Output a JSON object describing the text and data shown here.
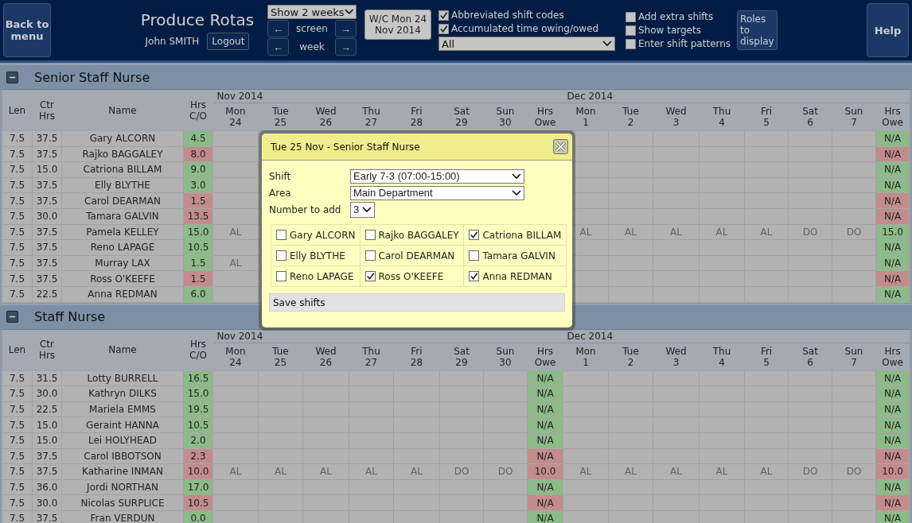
{
  "header": {
    "back_button": "Back to menu",
    "title": "Produce Rotas",
    "user": "John SMITH",
    "logout_button": "Logout",
    "range_select": "Show 2 weeks",
    "nav": [
      {
        "prev": "←",
        "label": "screen",
        "next": "→"
      },
      {
        "prev": "←",
        "label": "week",
        "next": "→"
      }
    ],
    "week_button": "W/C Mon 24 Nov 2014",
    "options": [
      {
        "label": "Abbreviated shift codes",
        "checked": true
      },
      {
        "label": "Accumulated time owing/owed",
        "checked": true
      }
    ],
    "filter_select": "All",
    "options_2": [
      {
        "label": "Add extra shifts",
        "checked": false
      },
      {
        "label": "Show targets",
        "checked": false
      },
      {
        "label": "Enter shift patterns",
        "checked": false
      }
    ],
    "roles_button": "Roles to display",
    "help_button": "Help"
  },
  "sections": [
    {
      "title": "Senior Staff Nurse",
      "expanded": true,
      "columns": [
        "Len",
        "Ctr Hrs",
        "Name",
        "Hrs C/O"
      ],
      "weeks": [
        {
          "month": "Nov 2014",
          "days": [
            {
              "day": "Mon",
              "date": "24"
            },
            {
              "day": "Tue",
              "date": "25"
            },
            {
              "day": "Wed",
              "date": "26"
            },
            {
              "day": "Thu",
              "date": "27"
            },
            {
              "day": "Fri",
              "date": "28"
            },
            {
              "day": "Sat",
              "date": "29"
            },
            {
              "day": "Sun",
              "date": "30"
            }
          ],
          "owe_header": "Hrs Owe"
        },
        {
          "month": "Dec 2014",
          "days": [
            {
              "day": "Mon",
              "date": "1"
            },
            {
              "day": "Tue",
              "date": "2"
            },
            {
              "day": "Wed",
              "date": "3"
            },
            {
              "day": "Thu",
              "date": "4"
            },
            {
              "day": "Fri",
              "date": "5"
            },
            {
              "day": "Sat",
              "date": "6"
            },
            {
              "day": "Sun",
              "date": "7"
            }
          ],
          "owe_header": "Hrs Owe"
        }
      ],
      "rows": [
        {
          "len": "7.5",
          "ctr": "37.5",
          "name": "Gary ALCORN",
          "co": {
            "text": "4.5",
            "color": "#8cba88"
          },
          "week2_owe": {
            "text": "N/A",
            "color": "#8cba88"
          }
        },
        {
          "len": "7.5",
          "ctr": "37.5",
          "name": "Rajko BAGGALEY",
          "co": {
            "text": "8.0",
            "color": "#c28c8c"
          },
          "week2_owe": {
            "text": "N/A",
            "color": "#c28c8c"
          }
        },
        {
          "len": "7.5",
          "ctr": "15.0",
          "name": "Catriona BILLAM",
          "co": {
            "text": "9.0",
            "color": "#8cba88"
          },
          "week2_owe": {
            "text": "N/A",
            "color": "#8cba88"
          }
        },
        {
          "len": "7.5",
          "ctr": "37.5",
          "name": "Elly BLYTHE",
          "co": {
            "text": "3.0",
            "color": "#8cba88"
          },
          "week2_owe": {
            "text": "N/A",
            "color": "#8cba88"
          }
        },
        {
          "len": "7.5",
          "ctr": "37.5",
          "name": "Carol DEARMAN",
          "co": {
            "text": "1.5",
            "color": "#c28c8c"
          },
          "week2_owe": {
            "text": "N/A",
            "color": "#c28c8c"
          }
        },
        {
          "len": "7.5",
          "ctr": "30.0",
          "name": "Tamara GALVIN",
          "co": {
            "text": "13.5",
            "color": "#c28c8c"
          },
          "week2_owe": {
            "text": "N/A",
            "color": "#c28c8c"
          }
        },
        {
          "len": "7.5",
          "ctr": "37.5",
          "name": "Pamela KELLEY",
          "co": {
            "text": "15.0",
            "color": "#8cba88"
          },
          "week1_shifts": [
            "AL"
          ],
          "week2_shifts": [
            "AL",
            "AL",
            "AL",
            "AL",
            "AL",
            "DO",
            "DO"
          ],
          "week2_owe": {
            "text": "15.0",
            "color": "#8cba88"
          }
        },
        {
          "len": "7.5",
          "ctr": "37.5",
          "name": "Reno LAPAGE",
          "co": {
            "text": "10.5",
            "color": "#8cba88"
          },
          "week2_owe": {
            "text": "N/A",
            "color": "#8cba88"
          }
        },
        {
          "len": "7.5",
          "ctr": "37.5",
          "name": "Murray LAX",
          "co": {
            "text": "1.5",
            "color": "#8cba88"
          },
          "week1_shifts": [
            "AL"
          ],
          "week2_owe": {
            "text": "N/A",
            "color": "#8cba88"
          }
        },
        {
          "len": "7.5",
          "ctr": "37.5",
          "name": "Ross O'KEEFE",
          "co": {
            "text": "1.5",
            "color": "#c28c8c"
          },
          "week2_owe": {
            "text": "N/A",
            "color": "#c28c8c"
          }
        },
        {
          "len": "7.5",
          "ctr": "22.5",
          "name": "Anna REDMAN",
          "co": {
            "text": "6.0",
            "color": "#8cba88"
          },
          "week2_owe": {
            "text": "N/A",
            "color": "#8cba88"
          }
        }
      ]
    },
    {
      "title": "Staff Nurse",
      "expanded": true,
      "columns": [
        "Len",
        "Ctr Hrs",
        "Name",
        "Hrs C/O"
      ],
      "weeks": [
        {
          "month": "Nov 2014",
          "days": [
            {
              "day": "Mon",
              "date": "24"
            },
            {
              "day": "Tue",
              "date": "25"
            },
            {
              "day": "Wed",
              "date": "26"
            },
            {
              "day": "Thu",
              "date": "27"
            },
            {
              "day": "Fri",
              "date": "28"
            },
            {
              "day": "Sat",
              "date": "29"
            },
            {
              "day": "Sun",
              "date": "30"
            }
          ],
          "owe_header": "Hrs Owe"
        },
        {
          "month": "Dec 2014",
          "days": [
            {
              "day": "Mon",
              "date": "1"
            },
            {
              "day": "Tue",
              "date": "2"
            },
            {
              "day": "Wed",
              "date": "3"
            },
            {
              "day": "Thu",
              "date": "4"
            },
            {
              "day": "Fri",
              "date": "5"
            },
            {
              "day": "Sat",
              "date": "6"
            },
            {
              "day": "Sun",
              "date": "7"
            }
          ],
          "owe_header": "Hrs Owe"
        }
      ],
      "rows": [
        {
          "len": "7.5",
          "ctr": "31.5",
          "name": "Lotty BURRELL",
          "co": {
            "text": "16.5",
            "color": "#8cba88"
          },
          "week1_owe": {
            "text": "N/A",
            "color": "#8cba88"
          },
          "week2_owe": {
            "text": "N/A",
            "color": "#8cba88"
          }
        },
        {
          "len": "7.5",
          "ctr": "30.0",
          "name": "Kathryn DILKS",
          "co": {
            "text": "15.0",
            "color": "#8cba88"
          },
          "week1_owe": {
            "text": "N/A",
            "color": "#8cba88"
          },
          "week2_owe": {
            "text": "N/A",
            "color": "#8cba88"
          }
        },
        {
          "len": "7.5",
          "ctr": "22.5",
          "name": "Mariela EMMS",
          "co": {
            "text": "19.5",
            "color": "#8cba88"
          },
          "week1_owe": {
            "text": "N/A",
            "color": "#8cba88"
          },
          "week2_owe": {
            "text": "N/A",
            "color": "#8cba88"
          }
        },
        {
          "len": "7.5",
          "ctr": "15.0",
          "name": "Geraint HANNA",
          "co": {
            "text": "10.5",
            "color": "#8cba88"
          },
          "week1_owe": {
            "text": "N/A",
            "color": "#8cba88"
          },
          "week2_owe": {
            "text": "N/A",
            "color": "#8cba88"
          }
        },
        {
          "len": "7.5",
          "ctr": "15.0",
          "name": "Lei HOLYHEAD",
          "co": {
            "text": "2.0",
            "color": "#8cba88"
          },
          "week1_owe": {
            "text": "N/A",
            "color": "#8cba88"
          },
          "week2_owe": {
            "text": "N/A",
            "color": "#8cba88"
          }
        },
        {
          "len": "7.5",
          "ctr": "37.5",
          "name": "Carol IBBOTSON",
          "co": {
            "text": "2.3",
            "color": "#c28c8c"
          },
          "week1_owe": {
            "text": "N/A",
            "color": "#c28c8c"
          },
          "week2_owe": {
            "text": "N/A",
            "color": "#c28c8c"
          }
        },
        {
          "len": "7.5",
          "ctr": "37.5",
          "name": "Katharine INMAN",
          "co": {
            "text": "10.0",
            "color": "#c28c8c"
          },
          "week1_shifts": [
            "AL",
            "AL",
            "AL",
            "AL",
            "AL",
            "DO",
            "DO"
          ],
          "week1_owe": {
            "text": "10.0",
            "color": "#c28c8c"
          },
          "week2_shifts": [
            "AL",
            "AL",
            "AL",
            "AL",
            "AL",
            "DO",
            "DO"
          ],
          "week2_owe": {
            "text": "10.0",
            "color": "#c28c8c"
          }
        },
        {
          "len": "7.5",
          "ctr": "36.0",
          "name": "Jordi NORTHAN",
          "co": {
            "text": "17.0",
            "color": "#8cba88"
          },
          "week1_owe": {
            "text": "N/A",
            "color": "#8cba88"
          },
          "week2_owe": {
            "text": "N/A",
            "color": "#8cba88"
          }
        },
        {
          "len": "7.5",
          "ctr": "30.0",
          "name": "Nicolas SURPLICE",
          "co": {
            "text": "10.5",
            "color": "#c28c8c"
          },
          "week1_owe": {
            "text": "N/A",
            "color": "#c28c8c"
          },
          "week2_owe": {
            "text": "N/A",
            "color": "#c28c8c"
          }
        },
        {
          "len": "7.5",
          "ctr": "37.5",
          "name": "Fran VERDUN",
          "co": {
            "text": "0.0",
            "color": "#8cba88"
          },
          "week1_owe": {
            "text": "N/A",
            "color": "#8cba88"
          },
          "week2_owe": {
            "text": "N/A",
            "color": "#8cba88"
          }
        }
      ]
    }
  ],
  "dialog": {
    "title": "Tue 25 Nov - Senior Staff Nurse",
    "fields": [
      {
        "label": "Shift",
        "value": "Early 7-3 (07:00-15:00)",
        "kind": "wide"
      },
      {
        "label": "Area",
        "value": "Main Department",
        "kind": "wide"
      },
      {
        "label": "Number to add",
        "value": "3",
        "kind": "narrow"
      }
    ],
    "staff": [
      {
        "name": "Gary ALCORN",
        "checked": false
      },
      {
        "name": "Rajko BAGGALEY",
        "checked": false
      },
      {
        "name": "Catriona BILLAM",
        "checked": true
      },
      {
        "name": "Elly BLYTHE",
        "checked": false
      },
      {
        "name": "Carol DEARMAN",
        "checked": false
      },
      {
        "name": "Tamara GALVIN",
        "checked": false
      },
      {
        "name": "Reno LAPAGE",
        "checked": false
      },
      {
        "name": "Ross O'KEEFE",
        "checked": true
      },
      {
        "name": "Anna REDMAN",
        "checked": true
      }
    ],
    "save_button": "Save shifts"
  }
}
